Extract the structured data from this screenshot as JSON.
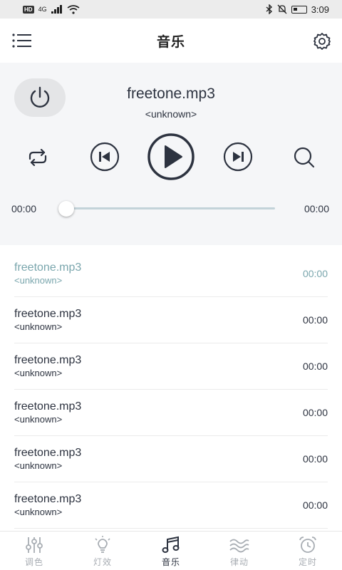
{
  "status_bar": {
    "hd": "HD",
    "network": "4G",
    "time": "3:09"
  },
  "header": {
    "title": "音乐"
  },
  "now_playing": {
    "title": "freetone.mp3",
    "artist": "<unknown>",
    "current_time": "00:00",
    "total_time": "00:00",
    "progress": 0
  },
  "playlist": [
    {
      "title": "freetone.mp3",
      "artist": "<unknown>",
      "duration": "00:00",
      "active": true
    },
    {
      "title": "freetone.mp3",
      "artist": "<unknown>",
      "duration": "00:00",
      "active": false
    },
    {
      "title": "freetone.mp3",
      "artist": "<unknown>",
      "duration": "00:00",
      "active": false
    },
    {
      "title": "freetone.mp3",
      "artist": "<unknown>",
      "duration": "00:00",
      "active": false
    },
    {
      "title": "freetone.mp3",
      "artist": "<unknown>",
      "duration": "00:00",
      "active": false
    },
    {
      "title": "freetone.mp3",
      "artist": "<unknown>",
      "duration": "00:00",
      "active": false
    }
  ],
  "tabs": [
    {
      "label": "调色",
      "icon": "sliders-icon",
      "active": false
    },
    {
      "label": "灯效",
      "icon": "bulb-icon",
      "active": false
    },
    {
      "label": "音乐",
      "icon": "music-note-icon",
      "active": true
    },
    {
      "label": "律动",
      "icon": "wave-icon",
      "active": false
    },
    {
      "label": "定时",
      "icon": "alarm-clock-icon",
      "active": false
    }
  ],
  "colors": {
    "accent": "#7aa6ad",
    "text": "#2d3340",
    "tab_inactive": "#a8adb3",
    "player_bg": "#f5f6f8"
  }
}
